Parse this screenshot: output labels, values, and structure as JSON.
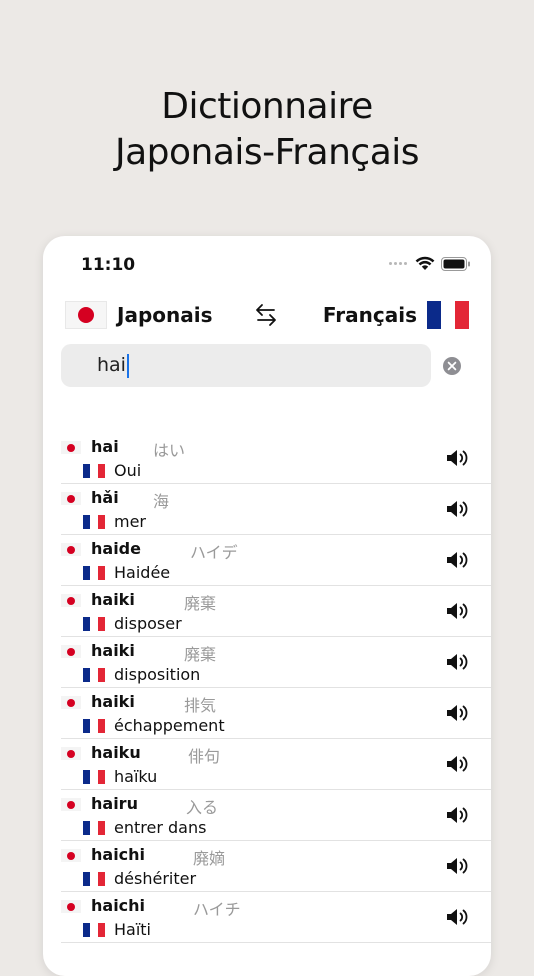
{
  "headline": {
    "line1": "Dictionnaire",
    "line2": "Japonais-Français"
  },
  "status": {
    "time": "11:10"
  },
  "lang_bar": {
    "source": "Japonais",
    "target": "Français"
  },
  "search": {
    "value": "hai"
  },
  "colors": {
    "jp_red": "#d50021",
    "fr_blue": "#0b2a8a",
    "fr_white": "#ffffff",
    "fr_red": "#e32636",
    "caret": "#1a73e8"
  },
  "results": [
    {
      "romaji": "hai",
      "kana": "はい",
      "fr": "Oui"
    },
    {
      "romaji": "hǎi",
      "kana": "海",
      "fr": "mer"
    },
    {
      "romaji": "haide",
      "kana": "ハイデ",
      "fr": "Haidée"
    },
    {
      "romaji": "haiki",
      "kana": "廃棄",
      "fr": "disposer"
    },
    {
      "romaji": "haiki",
      "kana": "廃棄",
      "fr": "disposition"
    },
    {
      "romaji": "haiki",
      "kana": "排気",
      "fr": "échappement"
    },
    {
      "romaji": "haiku",
      "kana": "俳句",
      "fr": "haïku"
    },
    {
      "romaji": "hairu",
      "kana": "入る",
      "fr": "entrer dans"
    },
    {
      "romaji": "haichi",
      "kana": "廃嫡",
      "fr": "déshériter"
    },
    {
      "romaji": "haichi",
      "kana": "ハイチ",
      "fr": "Haïti"
    }
  ]
}
